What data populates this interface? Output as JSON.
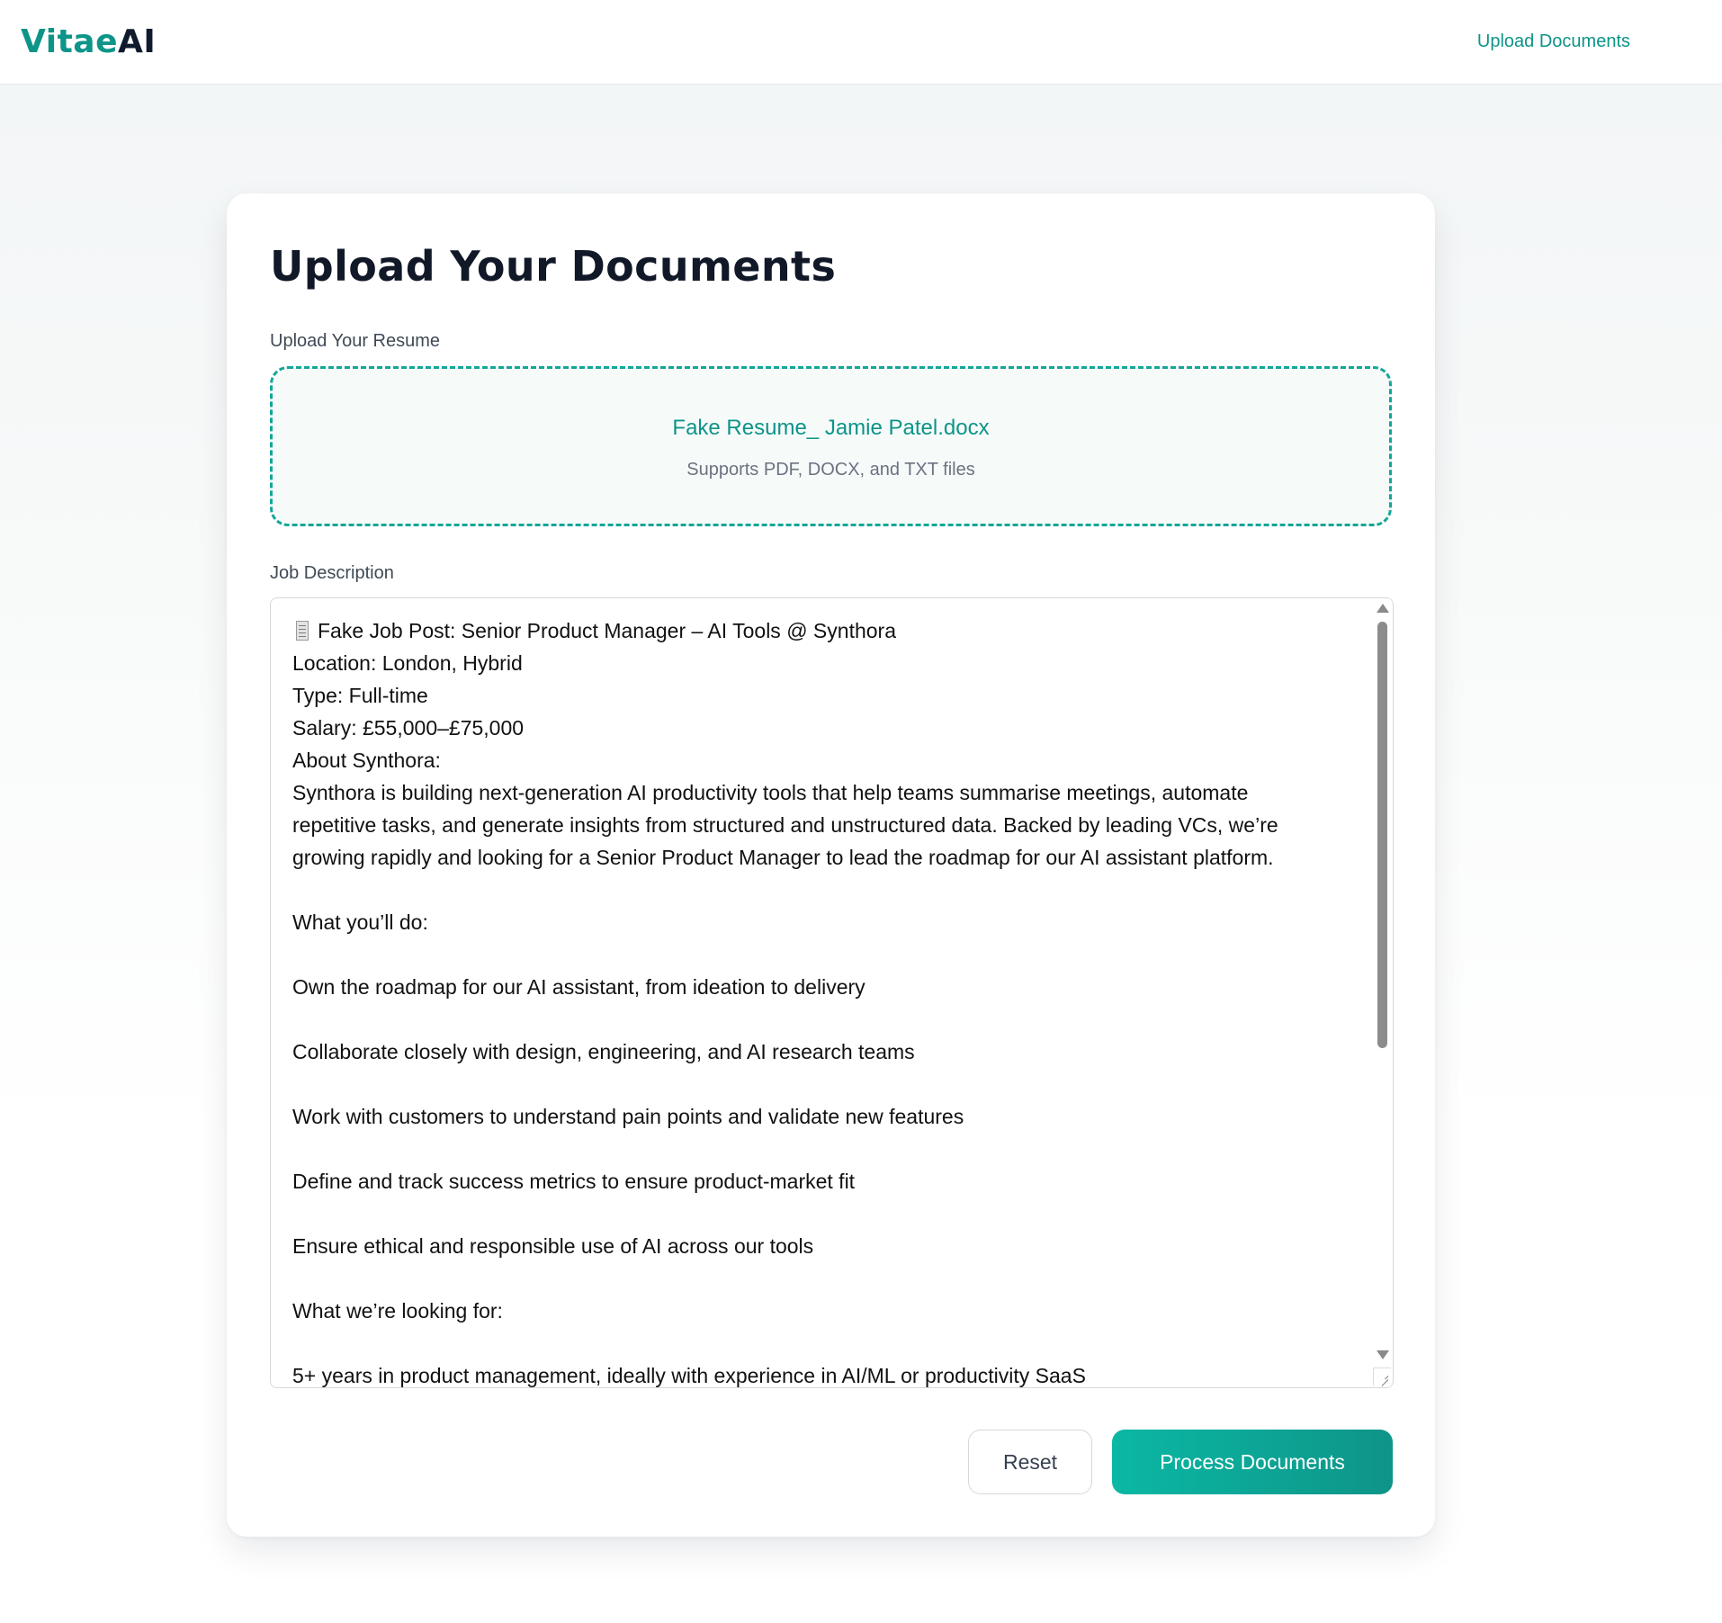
{
  "header": {
    "logo_part1": "Vitae",
    "logo_part2": "AI",
    "nav_link": "Upload Documents"
  },
  "main": {
    "title": "Upload Your Documents",
    "resume": {
      "label": "Upload Your Resume",
      "file_name": "Fake Resume_ Jamie Patel.docx",
      "hint": "Supports PDF, DOCX, and TXT files"
    },
    "job_description": {
      "label": "Job Description",
      "icon": "document-icon",
      "lines": [
        "Fake Job Post: Senior Product Manager – AI Tools @ Synthora",
        "Location: London, Hybrid",
        "Type: Full-time",
        "Salary: £55,000–£75,000",
        "About Synthora:",
        "Synthora is building next-generation AI productivity tools that help teams summarise meetings, automate",
        "repetitive tasks, and generate insights from structured and unstructured data. Backed by leading VCs, we’re",
        "growing rapidly and looking for a Senior Product Manager to lead the roadmap for our AI assistant platform.",
        "",
        "What you’ll do:",
        "",
        "Own the roadmap for our AI assistant, from ideation to delivery",
        "",
        "Collaborate closely with design, engineering, and AI research teams",
        "",
        "Work with customers to understand pain points and validate new features",
        "",
        "Define and track success metrics to ensure product-market fit",
        "",
        "Ensure ethical and responsible use of AI across our tools",
        "",
        "What we’re looking for:",
        "",
        "5+ years in product management, ideally with experience in AI/ML or productivity SaaS"
      ]
    },
    "buttons": {
      "reset": "Reset",
      "process": "Process Documents"
    }
  },
  "colors": {
    "accent": "#0e9488",
    "accent_light": "#0bb8a4",
    "heading": "#111827",
    "dropzone_border": "#14a697"
  }
}
